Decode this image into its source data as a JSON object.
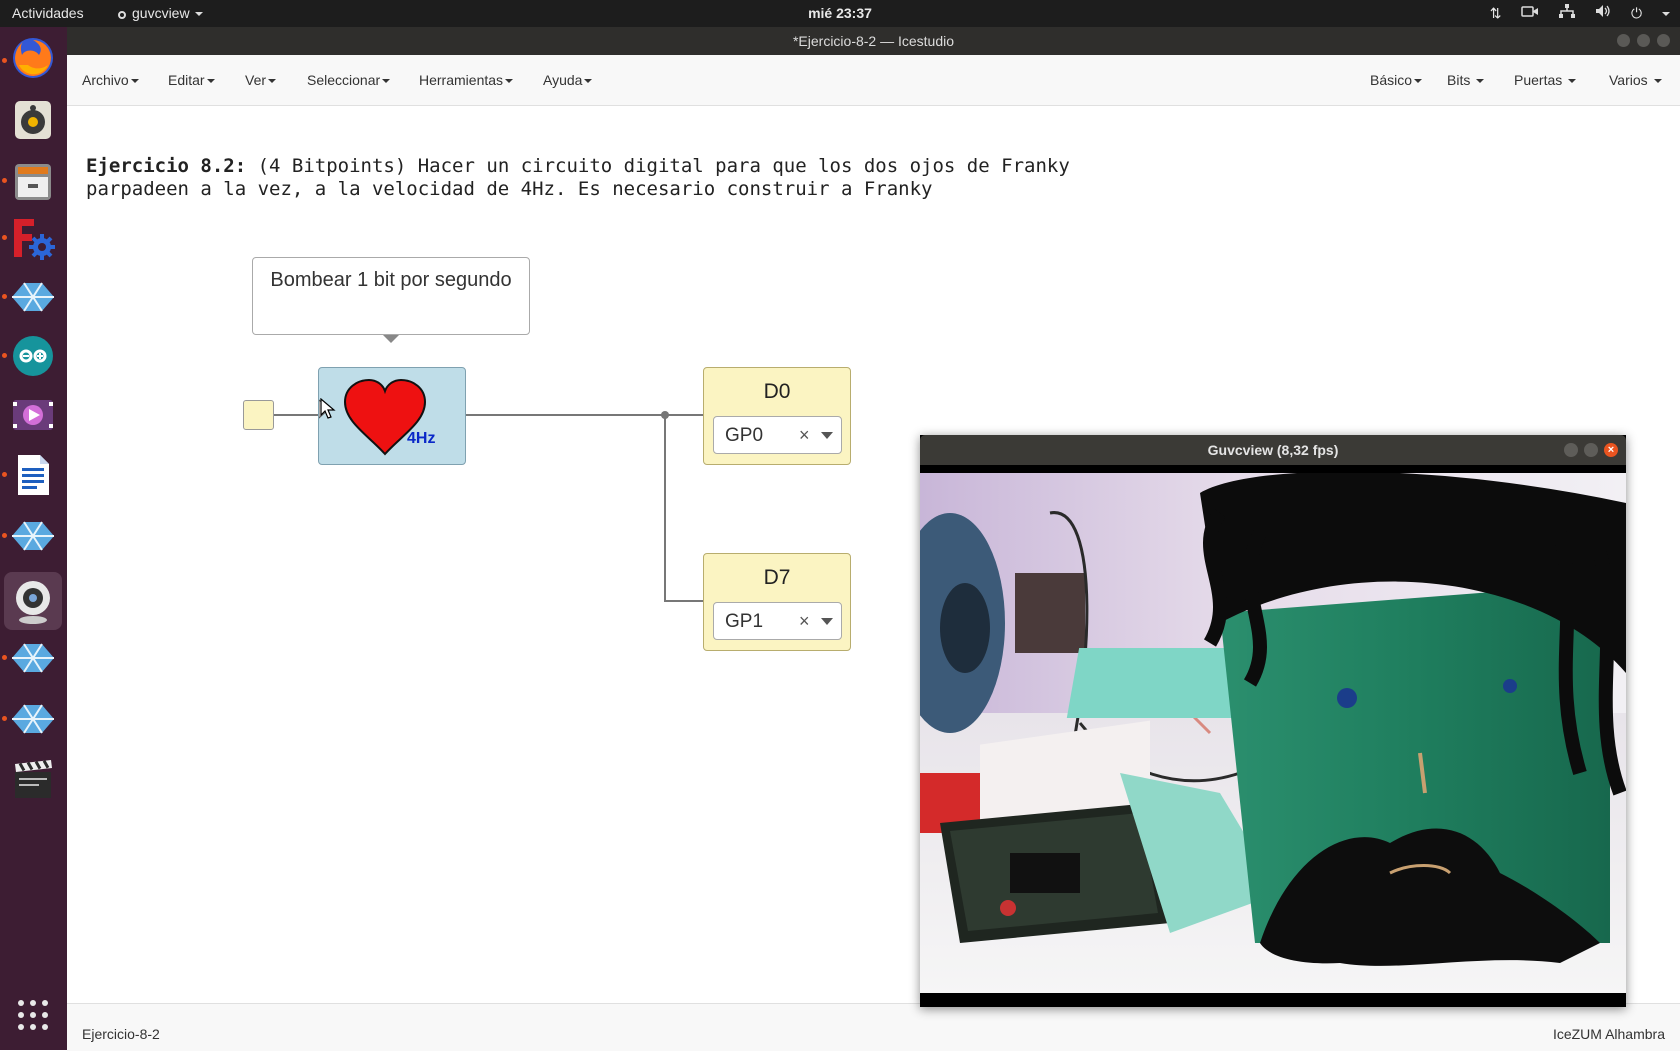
{
  "topbar": {
    "activities": "Actividades",
    "app_menu": "guvcview",
    "clock": "mié 23:37"
  },
  "window": {
    "title": "*Ejercicio-8-2 — Icestudio"
  },
  "menubar": {
    "left": [
      "Archivo",
      "Editar",
      "Ver",
      "Seleccionar",
      "Herramientas",
      "Ayuda"
    ],
    "right": [
      "Básico",
      "Bits",
      "Puertas",
      "Varios"
    ]
  },
  "canvas": {
    "description_bold": "Ejercicio 8.2:",
    "description_line1": " (4 Bitpoints) Hacer un circuito digital para que los dos ojos de Franky",
    "description_line2": "parpadeen a la vez, a la velocidad de 4Hz. Es necesario construir a Franky",
    "comment": "Bombear 1 bit por segundo",
    "heart_block": {
      "label": "4Hz"
    },
    "outputs": [
      {
        "name": "D0",
        "pin": "GP0",
        "clear": "×"
      },
      {
        "name": "D7",
        "pin": "GP1",
        "clear": "×"
      }
    ]
  },
  "statusbar": {
    "file": "Ejercicio-8-2",
    "board": "IceZUM Alhambra"
  },
  "guvcview": {
    "title": "Guvcview  (8,32 fps)",
    "close": "×"
  },
  "colors": {
    "topbar": "#1d1d1d",
    "dock": "#3d1d33",
    "accent": "#e95420",
    "heart_block": "#bfdde8",
    "io_block": "#fbf4c2",
    "heart": "#ee1111",
    "freq_text": "#0a28c8"
  },
  "icons": {
    "dock": [
      "firefox-icon",
      "rhythmbox-icon",
      "files-icon",
      "freecad-icon",
      "icestudio-icon",
      "arduino-icon",
      "video-editor-icon",
      "writer-icon",
      "icestudio-icon",
      "webcam-icon",
      "icestudio-icon",
      "icestudio-icon",
      "clapperboard-icon",
      "app-grid-icon"
    ],
    "tray": [
      "network-transfer-icon",
      "camera-icon",
      "network-icon",
      "volume-icon",
      "power-icon"
    ]
  }
}
